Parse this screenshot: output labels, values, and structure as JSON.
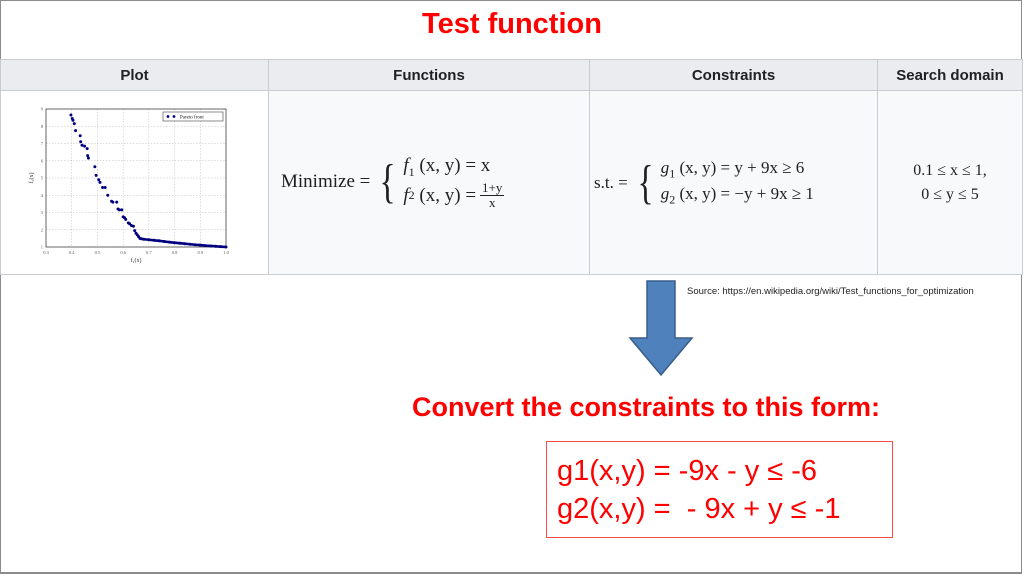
{
  "slide": {
    "title": "Test function",
    "source": "Source: https://en.wikipedia.org/wiki/Test_functions_for_optimization",
    "convert_heading": "Convert the constraints to this form:",
    "converted": [
      "g1(x,y) = -9x - y ≤ -6",
      "g2(x,y) =  - 9x + y ≤ -1"
    ],
    "colors": {
      "accent": "#ff0000",
      "arrow": "#4f81bd",
      "header_bg": "#eaecf0",
      "cell_bg": "#f8f9fa"
    }
  },
  "table": {
    "headers": [
      "Plot",
      "Functions",
      "Constraints",
      "Search domain"
    ],
    "functions": {
      "lead": "Minimize =",
      "f1_name": "f",
      "f1_sub": "1",
      "f1_args": "(x, y) = x",
      "f2_name": "f",
      "f2_sub": "2",
      "f2_args": "(x, y) =",
      "f2_num": "1+y",
      "f2_den": "x"
    },
    "constraints": {
      "lead": "s.t. =",
      "g1_name": "g",
      "g1_sub": "1",
      "g1_rest": "(x, y) = y + 9x ≥ 6",
      "g2_name": "g",
      "g2_sub": "2",
      "g2_rest": "(x, y) = −y + 9x ≥ 1"
    },
    "search_domain": [
      "0.1 ≤ x ≤ 1,",
      "0 ≤ y ≤ 5"
    ]
  },
  "chart_data": {
    "type": "scatter",
    "title": "",
    "xlabel": "f₁(x)",
    "ylabel": "f₂(x)",
    "xlim": [
      0.3,
      1.0
    ],
    "ylim": [
      1,
      9
    ],
    "xticks": [
      "0.3",
      "0.4",
      "0.5",
      "0.6",
      "0.7",
      "0.8",
      "0.9",
      "1.0"
    ],
    "yticks": [
      "1",
      "2",
      "3",
      "4",
      "5",
      "6",
      "7",
      "8",
      "9"
    ],
    "grid": true,
    "legend": {
      "position": "top-right",
      "entries": [
        "Pareto front"
      ]
    },
    "series": [
      {
        "name": "Pareto front",
        "color": "#00007f",
        "x": [
          0.397,
          0.402,
          0.405,
          0.41,
          0.415,
          0.433,
          0.435,
          0.44,
          0.45,
          0.46,
          0.462,
          0.465,
          0.49,
          0.495,
          0.505,
          0.51,
          0.52,
          0.53,
          0.54,
          0.555,
          0.56,
          0.575,
          0.58,
          0.585,
          0.595,
          0.6,
          0.605,
          0.61,
          0.62,
          0.625,
          0.632,
          0.64,
          0.645,
          0.65,
          0.655,
          0.66,
          0.665,
          0.67,
          0.68,
          0.7,
          0.72,
          0.74,
          0.76,
          0.78,
          0.8,
          0.82,
          0.84,
          0.86,
          0.88,
          0.9,
          0.92,
          0.94,
          0.96,
          0.98,
          1.0
        ],
        "y": [
          8.65,
          8.45,
          8.35,
          8.15,
          7.75,
          7.45,
          7.1,
          6.9,
          6.85,
          6.7,
          6.3,
          6.15,
          5.65,
          5.15,
          4.9,
          4.75,
          4.45,
          4.45,
          4.0,
          3.65,
          3.6,
          3.6,
          3.2,
          3.15,
          3.15,
          2.75,
          2.7,
          2.6,
          2.4,
          2.35,
          2.25,
          2.2,
          1.95,
          1.8,
          1.7,
          1.6,
          1.5,
          1.48,
          1.45,
          1.42,
          1.39,
          1.36,
          1.32,
          1.28,
          1.25,
          1.22,
          1.19,
          1.16,
          1.13,
          1.11,
          1.08,
          1.06,
          1.04,
          1.02,
          1.0
        ]
      }
    ]
  }
}
